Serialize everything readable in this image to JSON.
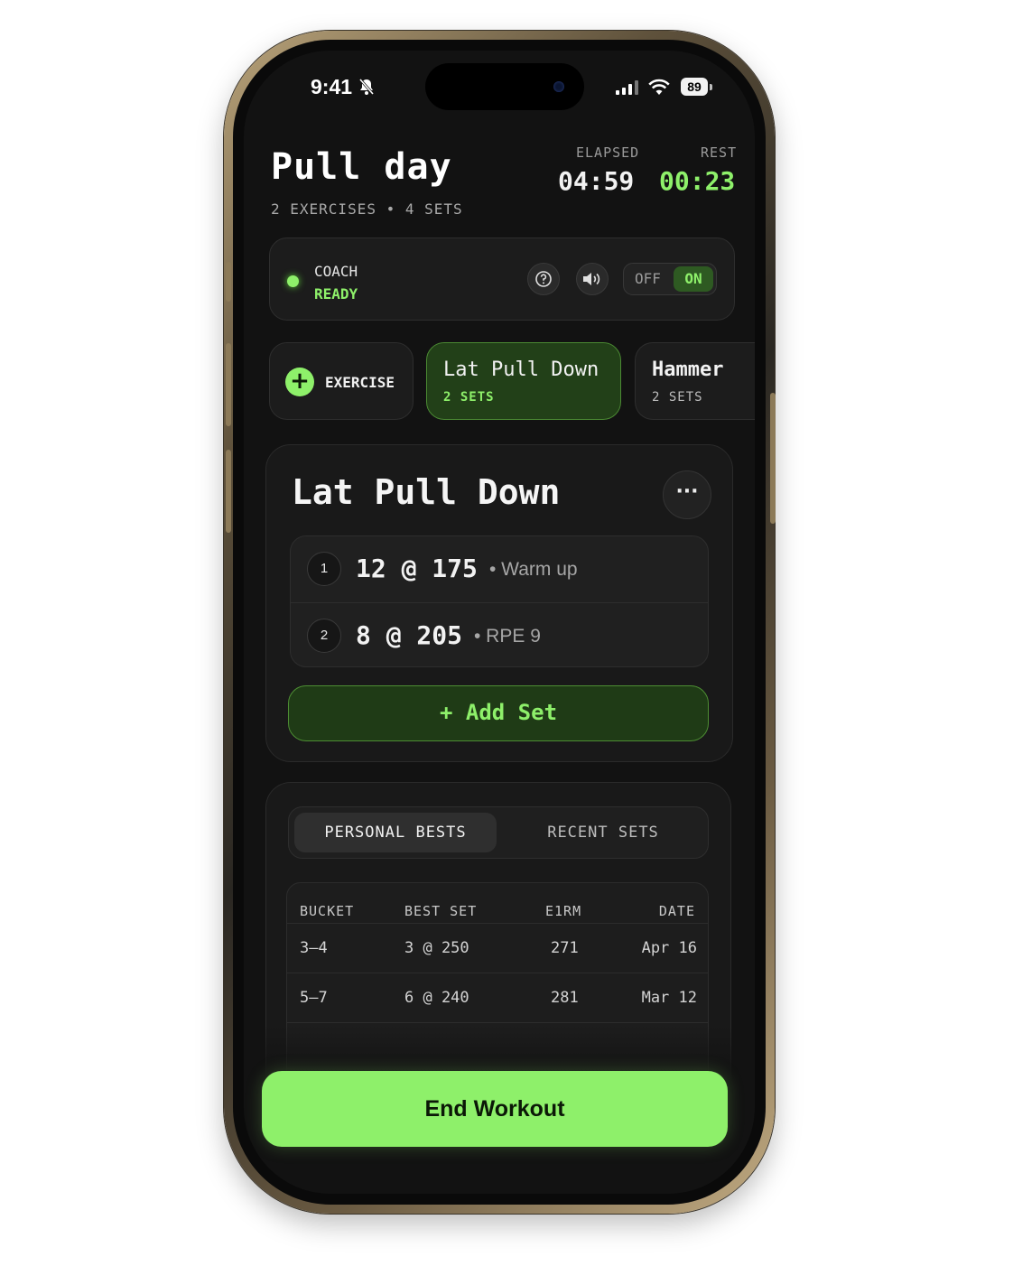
{
  "status_bar": {
    "time": "9:41",
    "battery": "89"
  },
  "workout": {
    "title": "Pull day",
    "summary": "2 EXERCISES • 4 SETS",
    "elapsed_label": "ELAPSED",
    "elapsed_value": "04:59",
    "rest_label": "REST",
    "rest_value": "00:23"
  },
  "coach": {
    "label": "COACH",
    "status": "READY",
    "toggle_off": "OFF",
    "toggle_on": "ON",
    "toggle_state": "on"
  },
  "exercise_chips": {
    "add_label": "EXERCISE",
    "items": [
      {
        "name": "Lat Pull Down",
        "sets": "2 SETS",
        "active": true
      },
      {
        "name": "Hammer",
        "sets": "2 SETS",
        "active": false
      }
    ]
  },
  "exercise_card": {
    "title": "Lat Pull Down",
    "more_label": "···",
    "sets": [
      {
        "number": "1",
        "main": "12 @ 175",
        "note": "• Warm up"
      },
      {
        "number": "2",
        "main": "8 @ 205",
        "note": "• RPE 9"
      }
    ],
    "add_set_label": "+ Add Set"
  },
  "stats": {
    "tabs": [
      "PERSONAL BESTS",
      "RECENT SETS"
    ],
    "active_tab": "PERSONAL BESTS",
    "columns": [
      "BUCKET",
      "BEST SET",
      "E1RM",
      "DATE"
    ],
    "rows": [
      [
        "3–4",
        "3 @ 250",
        "271",
        "Apr 16"
      ],
      [
        "5–7",
        "6 @ 240",
        "281",
        "Mar 12"
      ]
    ]
  },
  "end_button": {
    "label": "End Workout"
  },
  "colors": {
    "accent": "#8ef06a",
    "background": "#121212",
    "card": "#191919"
  }
}
